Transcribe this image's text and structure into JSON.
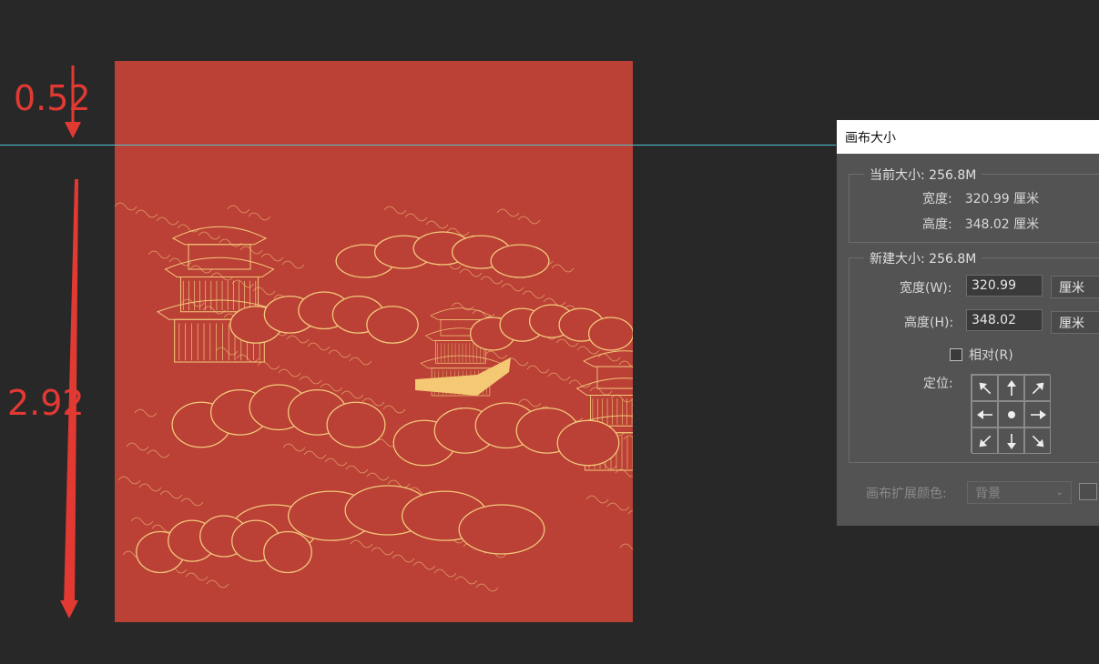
{
  "annotations": {
    "top_measure": "0.52",
    "bottom_measure": "2.92",
    "color": "#e23a33"
  },
  "artwork": {
    "background_color": "#bb4036",
    "line_color": "#f2c97a",
    "highlight_color": "#f5c873"
  },
  "dialog": {
    "title": "画布大小",
    "current": {
      "title": "当前大小: 256.8M",
      "width_label": "宽度:",
      "width_value": "320.99 厘米",
      "height_label": "高度:",
      "height_value": "348.02 厘米"
    },
    "new": {
      "title": "新建大小: 256.8M",
      "width_label": "宽度(W):",
      "width_value": "320.99",
      "width_unit": "厘米",
      "height_label": "高度(H):",
      "height_value": "348.02",
      "height_unit": "厘米",
      "relative_label": "相对(R)",
      "relative_checked": false,
      "anchor_label": "定位:",
      "anchor_icons": [
        "arrow-up-left-icon",
        "arrow-up-icon",
        "arrow-up-right-icon",
        "arrow-left-icon",
        "center-dot-icon",
        "arrow-right-icon",
        "arrow-down-left-icon",
        "arrow-down-icon",
        "arrow-down-right-icon"
      ]
    },
    "extension_color_label": "画布扩展颜色:",
    "extension_color_value": "背景"
  }
}
